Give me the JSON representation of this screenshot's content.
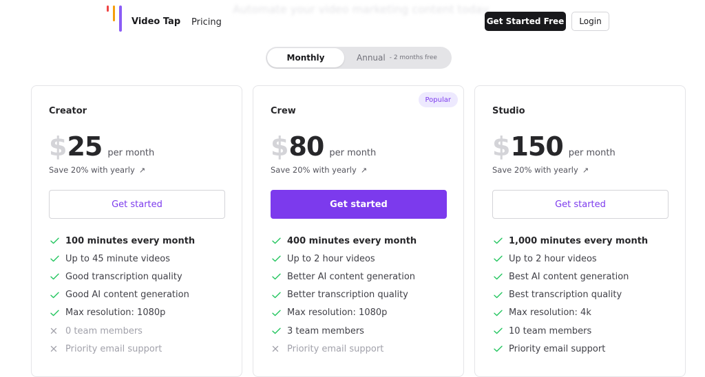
{
  "header": {
    "brand": "Video Tap",
    "nav_pricing": "Pricing",
    "tagline": "Automate your video marketing content today",
    "get_started_free": "Get Started Free",
    "login": "Login"
  },
  "billing_toggle": {
    "monthly": "Monthly",
    "annual": "Annual",
    "annual_note": "- 2 months free",
    "selected": "Monthly"
  },
  "colors": {
    "accent": "#7c3aed",
    "check": "#22c55e",
    "cross": "#a1a1aa",
    "dark_button": "#18181b"
  },
  "plans": [
    {
      "name": "Creator",
      "currency": "$",
      "price": "25",
      "period": "per month",
      "save": "Save 20% with yearly",
      "save_icon": "arrow-up-right-icon",
      "cta": "Get started",
      "features": [
        {
          "text": "100 minutes every month",
          "included": true,
          "strong": true
        },
        {
          "text": "Up to 45 minute videos",
          "included": true
        },
        {
          "text": "Good transcription quality",
          "included": true
        },
        {
          "text": "Good AI content generation",
          "included": true
        },
        {
          "text": "Max resolution: 1080p",
          "included": true
        },
        {
          "text": "0 team members",
          "included": false
        },
        {
          "text": "Priority email support",
          "included": false
        }
      ]
    },
    {
      "name": "Crew",
      "badge": "Popular",
      "currency": "$",
      "price": "80",
      "period": "per month",
      "save": "Save 20% with yearly",
      "save_icon": "arrow-up-right-icon",
      "cta": "Get started",
      "features": [
        {
          "text": "400 minutes every month",
          "included": true,
          "strong": true
        },
        {
          "text": "Up to 2 hour videos",
          "included": true
        },
        {
          "text": "Better AI content generation",
          "included": true
        },
        {
          "text": "Better transcription quality",
          "included": true
        },
        {
          "text": "Max resolution: 1080p",
          "included": true
        },
        {
          "text": "3 team members",
          "included": true
        },
        {
          "text": "Priority email support",
          "included": false
        }
      ]
    },
    {
      "name": "Studio",
      "currency": "$",
      "price": "150",
      "period": "per month",
      "save": "Save 20% with yearly",
      "save_icon": "arrow-up-right-icon",
      "cta": "Get started",
      "features": [
        {
          "text": "1,000 minutes every month",
          "included": true,
          "strong": true
        },
        {
          "text": "Up to 2 hour videos",
          "included": true
        },
        {
          "text": "Best AI content generation",
          "included": true
        },
        {
          "text": "Best transcription quality",
          "included": true
        },
        {
          "text": "Max resolution: 4k",
          "included": true
        },
        {
          "text": "10 team members",
          "included": true
        },
        {
          "text": "Priority email support",
          "included": true
        }
      ]
    }
  ]
}
